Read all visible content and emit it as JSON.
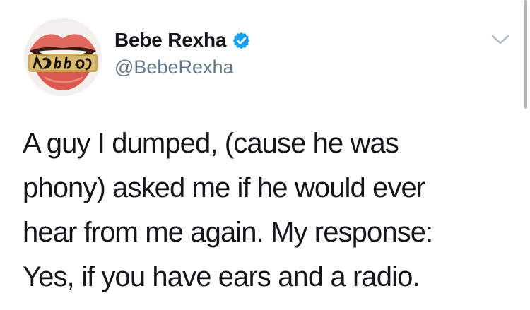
{
  "tweet": {
    "author": {
      "display_name": "Bebe Rexha",
      "handle": "@BebeRexha",
      "verified": true,
      "avatar_icon": "lips-grill-avatar-icon"
    },
    "menu_icon": "chevron-down-icon",
    "text_lines": [
      "A guy I dumped, (cause he was",
      "phony) asked me if he would ever",
      "hear from me again. My response:",
      "Yes, if you have ears and a radio."
    ]
  },
  "colors": {
    "verified_badge": "#1da1f2",
    "handle_text": "#657786",
    "chevron": "#aab8c2",
    "lips": "#e0685c"
  }
}
